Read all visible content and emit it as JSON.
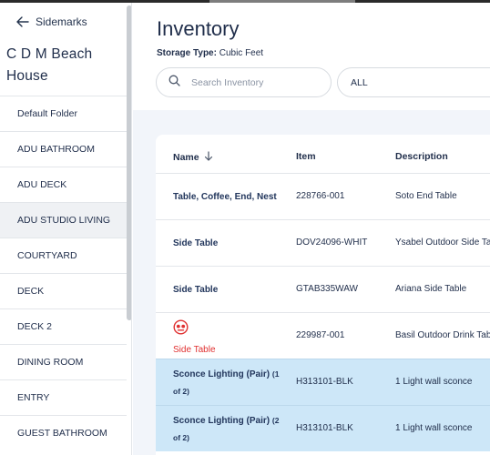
{
  "sidebar": {
    "back_label": "Sidemarks",
    "project_title": "C D M Beach House",
    "folders": [
      {
        "label": "Default Folder"
      },
      {
        "label": "ADU BATHROOM"
      },
      {
        "label": "ADU DECK"
      },
      {
        "label": "ADU STUDIO LIVING"
      },
      {
        "label": "COURTYARD"
      },
      {
        "label": "DECK"
      },
      {
        "label": "DECK 2"
      },
      {
        "label": "DINING ROOM"
      },
      {
        "label": "ENTRY"
      },
      {
        "label": "GUEST BATHROOM"
      }
    ],
    "active_folder": "ADU STUDIO LIVING"
  },
  "header": {
    "title": "Inventory",
    "storage_label": "Storage Type:",
    "storage_value": "Cubic Feet"
  },
  "search": {
    "placeholder": "Search Inventory",
    "value": ""
  },
  "filter": {
    "selected": "ALL"
  },
  "table": {
    "columns": {
      "name": "Name",
      "item": "Item",
      "description": "Description"
    },
    "sort": "descending",
    "rows": [
      {
        "name": "Table, Coffee, End, Nest",
        "suffix": "",
        "item": "228766-001",
        "description": "Soto End Table",
        "selected": false,
        "flagged": false
      },
      {
        "name": "Side Table",
        "suffix": "",
        "item": "DOV24096-WHIT",
        "description": "Ysabel Outdoor Side Tal",
        "selected": false,
        "flagged": false
      },
      {
        "name": "Side Table",
        "suffix": "",
        "item": "GTAB335WAW",
        "description": "Ariana Side Table",
        "selected": false,
        "flagged": false
      },
      {
        "name": "Side Table",
        "suffix": "",
        "item": "229987-001",
        "description": "Basil Outdoor Drink Tab",
        "selected": false,
        "flagged": true
      },
      {
        "name": "Sconce Lighting (Pair)",
        "suffix": "(1 of 2)",
        "item": "H313101-BLK",
        "description": "1 Light wall sconce",
        "selected": true,
        "flagged": false
      },
      {
        "name": "Sconce Lighting (Pair)",
        "suffix": "(2 of 2)",
        "item": "H313101-BLK",
        "description": "1 Light wall sconce",
        "selected": true,
        "flagged": false
      }
    ]
  },
  "colors": {
    "text": "#1f2d4a",
    "selected_row": "#cde7f8",
    "alert": "#e03131",
    "main_bg": "#f2f5fa"
  }
}
